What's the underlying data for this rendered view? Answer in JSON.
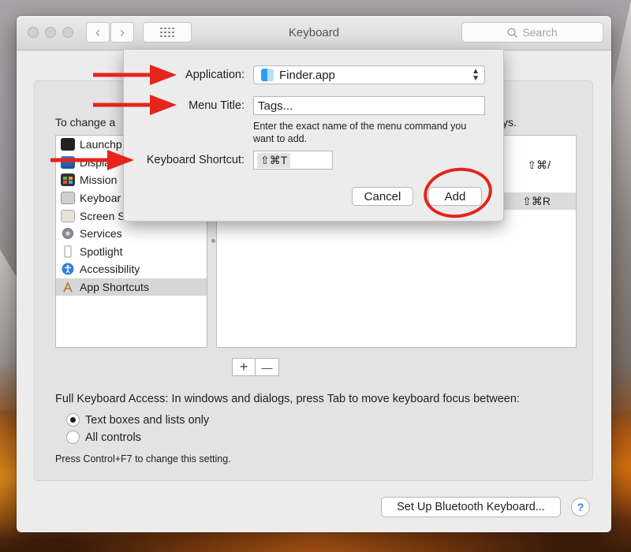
{
  "window": {
    "title": "Keyboard",
    "search_placeholder": "Search",
    "nav_back": "‹",
    "nav_forward": "›"
  },
  "main": {
    "instruction_prefix": "To change a",
    "instruction_suffix": "ys.",
    "categories": [
      {
        "label": "Launchp",
        "icon": "launchpad-icon",
        "selected": false
      },
      {
        "label": "Displa",
        "icon": "display-icon",
        "selected": false
      },
      {
        "label": "Mission",
        "icon": "mission-control-icon",
        "selected": false
      },
      {
        "label": "Keyboar",
        "icon": "keyboard-icon",
        "selected": false
      },
      {
        "label": "Screen S",
        "icon": "screenshot-icon",
        "selected": false
      },
      {
        "label": "Services",
        "icon": "gear-icon",
        "selected": false
      },
      {
        "label": "Spotlight",
        "icon": "spotlight-icon",
        "selected": false
      },
      {
        "label": "Accessibility",
        "icon": "accessibility-icon",
        "selected": false
      },
      {
        "label": "App Shortcuts",
        "icon": "app-store-icon",
        "selected": true
      }
    ],
    "shortcut_rows": [
      {
        "keys": "⇧⌘/",
        "selected": false
      },
      {
        "keys": "⇧⌘R",
        "selected": true
      }
    ],
    "add_symbol": "+",
    "remove_symbol": "—",
    "full_keyboard_access": "Full Keyboard Access: In windows and dialogs, press Tab to move keyboard focus between:",
    "radio_options": [
      {
        "label": "Text boxes and lists only",
        "checked": true
      },
      {
        "label": "All controls",
        "checked": false
      }
    ],
    "hint": "Press Control+F7 to change this setting.",
    "bluetooth_button": "Set Up Bluetooth Keyboard...",
    "help_symbol": "?"
  },
  "sheet": {
    "application_label": "Application:",
    "application_value": "Finder.app",
    "menu_title_label": "Menu Title:",
    "menu_title_value": "Tags...",
    "helptext": "Enter the exact name of the menu command you want to add.",
    "shortcut_label": "Keyboard Shortcut:",
    "shortcut_value": "⇧⌘T",
    "cancel_label": "Cancel",
    "add_label": "Add"
  },
  "colors": {
    "annotation_red": "#e5241b",
    "help_blue": "#2f7fe0"
  }
}
